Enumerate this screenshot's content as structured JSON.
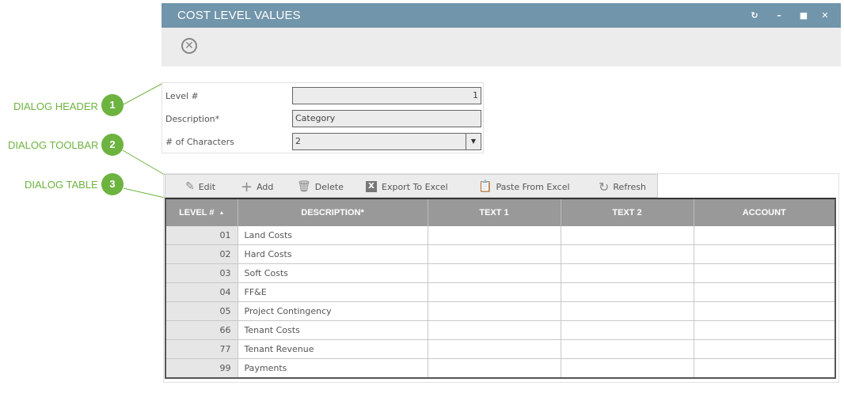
{
  "window": {
    "title": "COST LEVEL VALUES",
    "controls": [
      "refresh-icon",
      "minimize-icon",
      "maximize-icon",
      "close-icon"
    ]
  },
  "annotations": [
    {
      "label": "DIALOG HEADER",
      "number": "1"
    },
    {
      "label": "DIALOG TOOLBAR",
      "number": "2"
    },
    {
      "label": "DIALOG TABLE",
      "number": "3"
    }
  ],
  "colors": {
    "titlebar": "#7195aa",
    "annotation_green": "#6db33f",
    "grid_header": "#999999"
  },
  "form": {
    "level_label": "Level #",
    "level_value": "1",
    "description_label": "Description*",
    "description_value": "Category",
    "chars_label": "# of Characters",
    "chars_value": "2"
  },
  "toolbar": {
    "edit": "Edit",
    "add": "Add",
    "delete": "Delete",
    "export": "Export To Excel",
    "paste": "Paste From Excel",
    "refresh": "Refresh"
  },
  "table": {
    "columns": [
      "LEVEL #",
      "DESCRIPTION*",
      "TEXT 1",
      "TEXT 2",
      "ACCOUNT"
    ],
    "sort": "ascending",
    "rows": [
      {
        "level": "01",
        "description": "Land Costs",
        "text1": "",
        "text2": "",
        "account": ""
      },
      {
        "level": "02",
        "description": "Hard Costs",
        "text1": "",
        "text2": "",
        "account": ""
      },
      {
        "level": "03",
        "description": "Soft Costs",
        "text1": "",
        "text2": "",
        "account": ""
      },
      {
        "level": "04",
        "description": "FF&E",
        "text1": "",
        "text2": "",
        "account": ""
      },
      {
        "level": "05",
        "description": "Project Contingency",
        "text1": "",
        "text2": "",
        "account": ""
      },
      {
        "level": "66",
        "description": "Tenant Costs",
        "text1": "",
        "text2": "",
        "account": ""
      },
      {
        "level": "77",
        "description": "Tenant Revenue",
        "text1": "",
        "text2": "",
        "account": ""
      },
      {
        "level": "99",
        "description": "Payments",
        "text1": "",
        "text2": "",
        "account": ""
      }
    ]
  }
}
